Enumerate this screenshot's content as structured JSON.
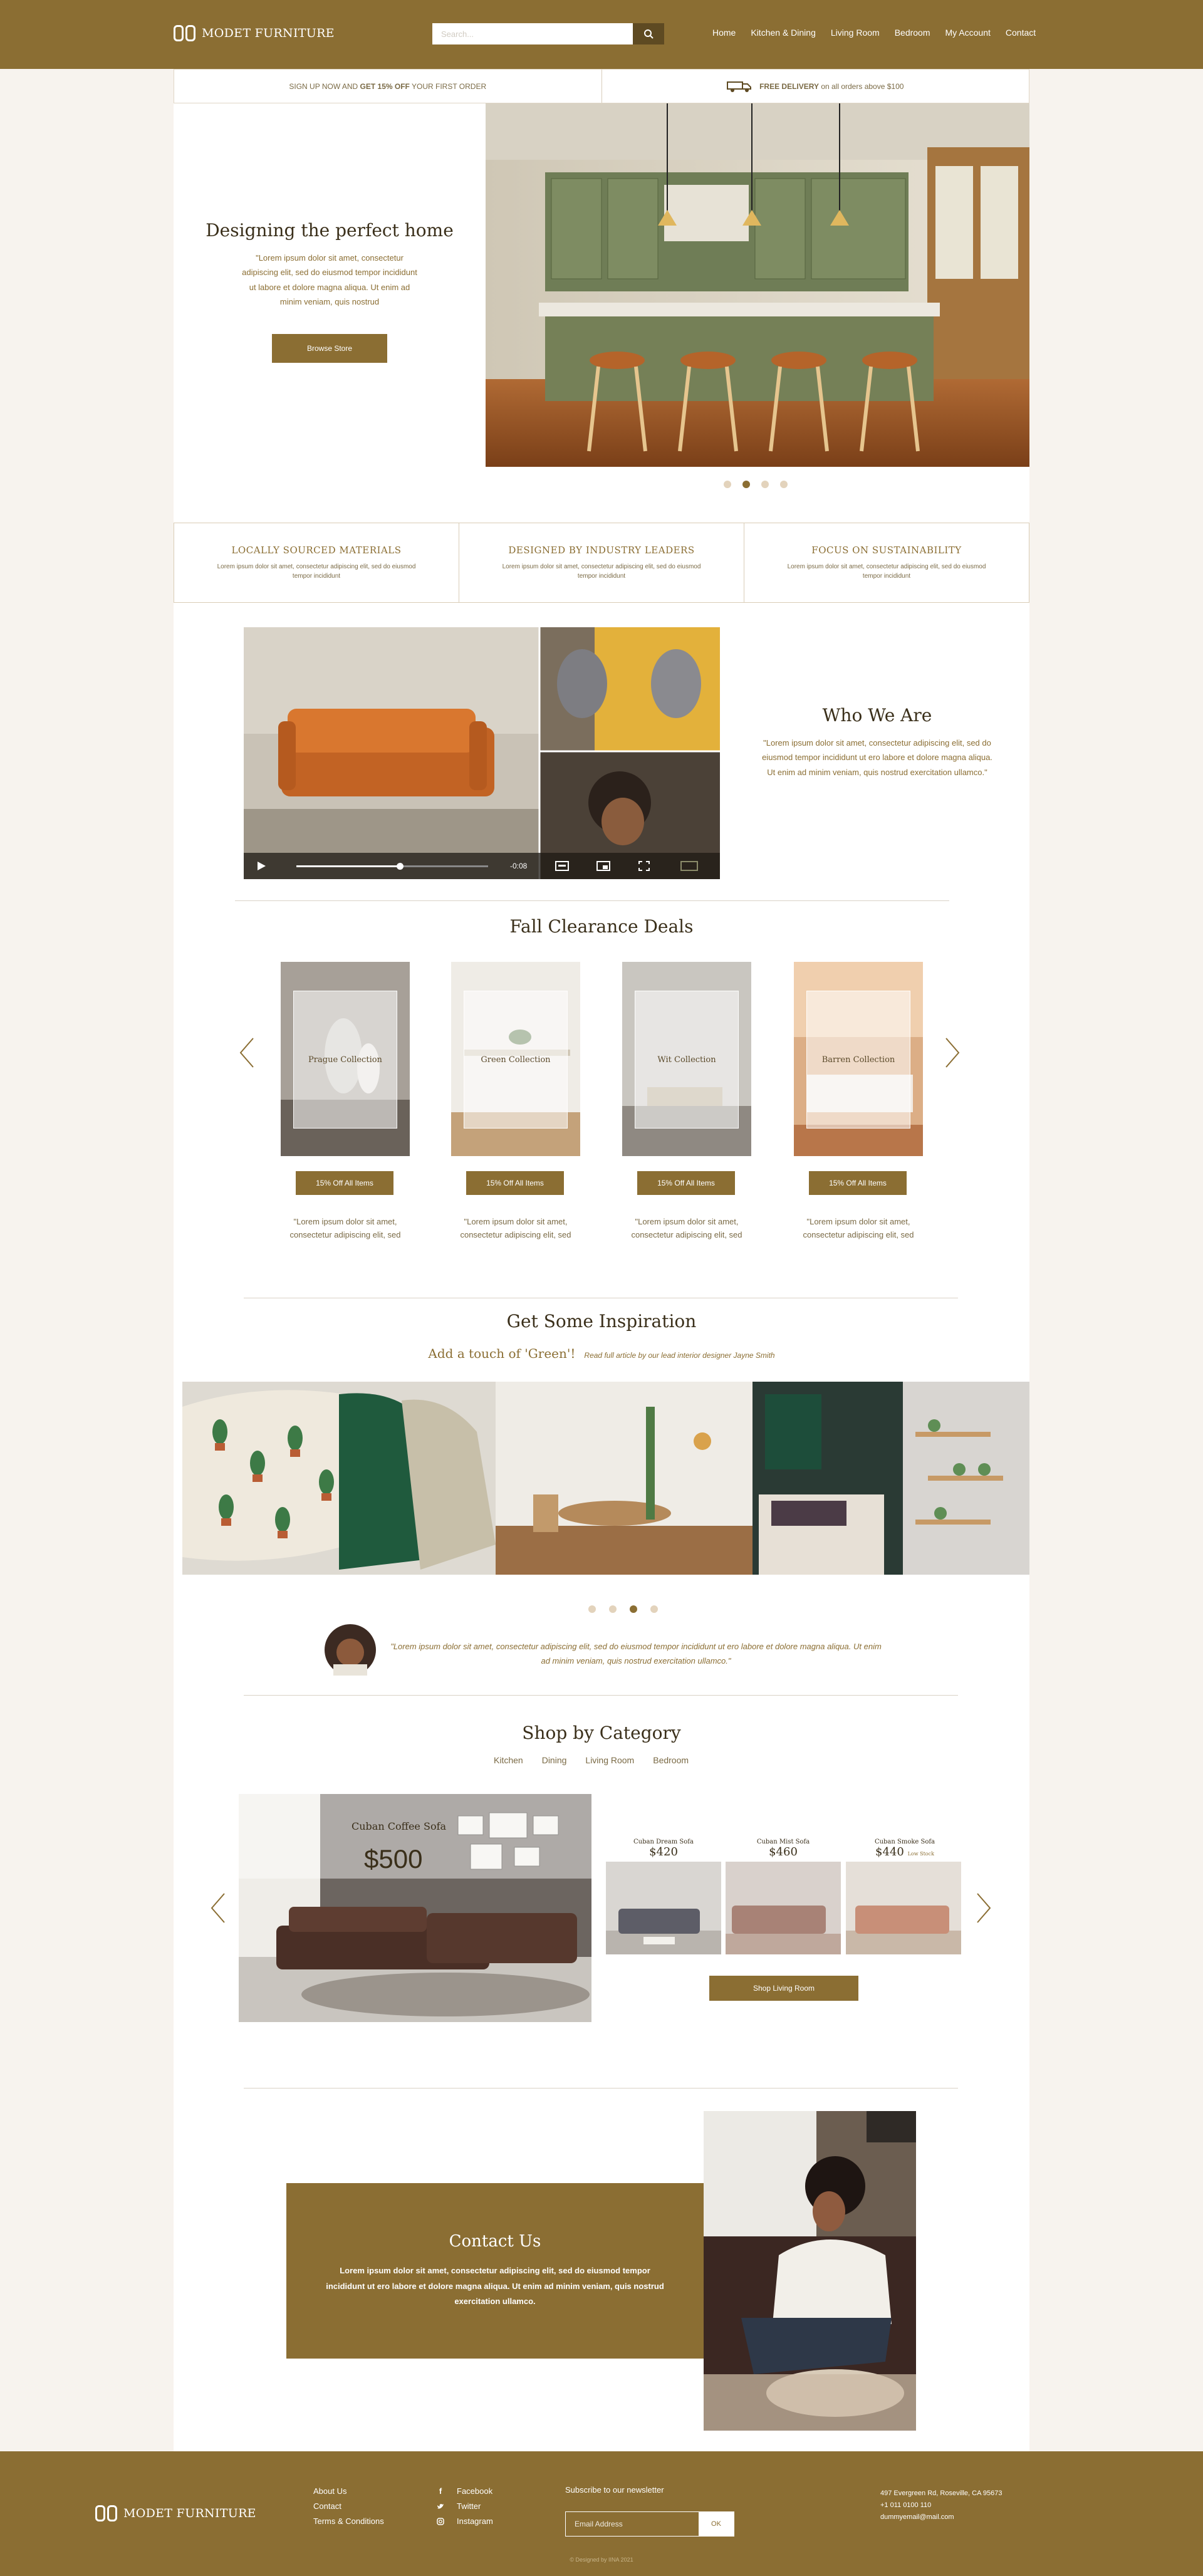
{
  "header": {
    "logo_text": "MODET FURNITURE",
    "search_placeholder": "Search...",
    "nav": [
      "Home",
      "Kitchen & Dining",
      "Living Room",
      "Bedroom",
      "My Account",
      "Contact"
    ]
  },
  "promo": {
    "signup_pre": "SIGN UP NOW AND ",
    "signup_bold": "GET 15% OFF",
    "signup_post": " YOUR FIRST ORDER",
    "delivery_bold": "FREE DELIVERY",
    "delivery_post": " on all orders above $100"
  },
  "hero": {
    "title": "Designing the perfect home",
    "text": "\"Lorem ipsum dolor sit amet, consectetur adipiscing elit, sed do eiusmod tempor incididunt ut labore et dolore magna aliqua. Ut enim ad minim veniam, quis nostrud",
    "button": "Browse Store",
    "active_slide": 2,
    "slide_count": 4
  },
  "features": [
    {
      "title": "LOCALLY SOURCED MATERIALS",
      "text": "Lorem ipsum dolor sit amet, consectetur adipiscing elit, sed do eiusmod tempor incididunt"
    },
    {
      "title": "DESIGNED BY INDUSTRY LEADERS",
      "text": "Lorem ipsum dolor sit amet, consectetur adipiscing elit, sed do eiusmod tempor incididunt"
    },
    {
      "title": "FOCUS ON SUSTAINABILITY",
      "text": "Lorem ipsum dolor sit amet, consectetur adipiscing elit, sed do eiusmod tempor incididunt"
    }
  ],
  "video": {
    "time": "-0:08",
    "progress": 0.54
  },
  "who": {
    "title": "Who We Are",
    "text": "\"Lorem ipsum dolor sit amet, consectetur adipiscing elit, sed do eiusmod tempor incididunt ut ero labore et dolore magna aliqua. Ut enim ad minim veniam, quis nostrud exercitation ullamco.\""
  },
  "deals": {
    "title": "Fall Clearance Deals",
    "items": [
      {
        "name": "Prague Collection",
        "button": "15% Off All Items",
        "desc": "\"Lorem ipsum dolor sit amet, consectetur adipiscing elit, sed"
      },
      {
        "name": "Green Collection",
        "button": "15% Off All Items",
        "desc": "\"Lorem ipsum dolor sit amet, consectetur adipiscing elit, sed"
      },
      {
        "name": "Wit Collection",
        "button": "15% Off All Items",
        "desc": "\"Lorem ipsum dolor sit amet, consectetur adipiscing elit, sed"
      },
      {
        "name": "Barren Collection",
        "button": "15% Off All Items",
        "desc": "\"Lorem ipsum dolor sit amet, consectetur adipiscing elit, sed"
      }
    ]
  },
  "inspiration": {
    "title": "Get Some Inspiration",
    "subtitle": "Add a touch of 'Green'!",
    "note": "Read full article by our lead interior designer Jayne Smith",
    "active_slide": 3,
    "slide_count": 4,
    "quote": "\"Lorem ipsum dolor sit amet, consectetur adipiscing elit, sed do eiusmod tempor incididunt ut ero labore et dolore magna aliqua. Ut enim ad minim veniam, quis nostrud exercitation ullamco.\""
  },
  "category": {
    "title": "Shop by Category",
    "tabs": [
      "Kitchen",
      "Dining",
      "Living Room",
      "Bedroom"
    ],
    "featured": {
      "name": "Cuban Coffee Sofa",
      "price": "$500"
    },
    "items": [
      {
        "name": "Cuban Dream Sofa",
        "price": "$420",
        "note": ""
      },
      {
        "name": "Cuban Mist Sofa",
        "price": "$460",
        "note": ""
      },
      {
        "name": "Cuban Smoke Sofa",
        "price": "$440",
        "note": "Low Stock"
      }
    ],
    "button": "Shop Living Room"
  },
  "contact": {
    "title": "Contact Us",
    "text": "Lorem ipsum dolor sit amet, consectetur adipiscing elit, sed do eiusmod tempor incididunt ut ero labore et dolore magna aliqua. Ut enim ad minim veniam, quis nostrud exercitation ullamco."
  },
  "footer": {
    "logo_text": "MODET FURNITURE",
    "links": [
      "About Us",
      "Contact",
      "Terms & Conditions"
    ],
    "social": [
      {
        "label": "Facebook",
        "icon": "facebook-icon"
      },
      {
        "label": "Twitter",
        "icon": "twitter-icon"
      },
      {
        "label": "Instagram",
        "icon": "instagram-icon"
      }
    ],
    "newsletter_label": "Subscribe to our newsletter",
    "email_placeholder": "Email Address",
    "ok": "OK",
    "address": "497 Evergreen Rd, Roseville, CA 95673",
    "phone": "+1 011 0100 110",
    "email": "dummyemail@mail.com",
    "credit": "© Designed by IINA 2021"
  },
  "colors": {
    "brand": "#8b6e33",
    "dark_brand": "#5e4a22",
    "background": "#f7f3ee",
    "dot_inactive": "#e3d3bc"
  }
}
